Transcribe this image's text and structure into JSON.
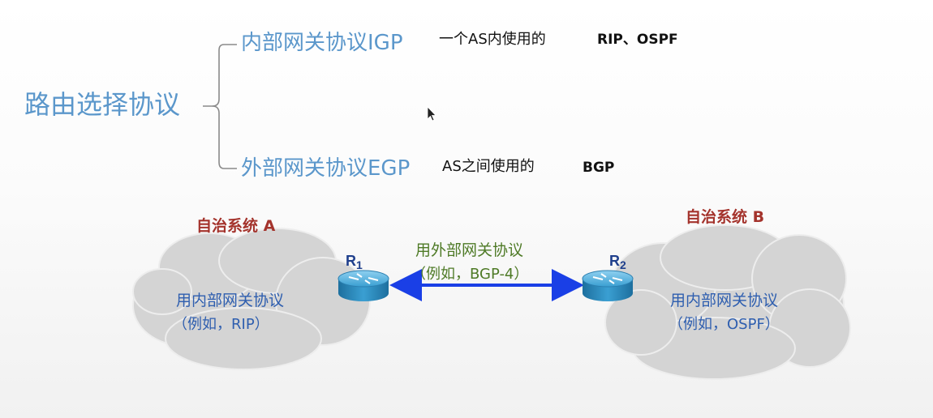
{
  "taxonomy": {
    "root": "路由选择协议",
    "igp": {
      "name": "内部网关协议IGP",
      "desc": "一个AS内使用的",
      "examples": "RIP、OSPF"
    },
    "egp": {
      "name": "外部网关协议EGP",
      "desc": "AS之间使用的",
      "examples": "BGP"
    }
  },
  "diagram": {
    "as_a": {
      "title": "自治系统 A",
      "line1": "用内部网关协议",
      "line2": "（例如，RIP）"
    },
    "as_b": {
      "title": "自治系统 B",
      "line1": "用内部网关协议",
      "line2": "（例如，OSPF）"
    },
    "link": {
      "line1": "用外部网关协议",
      "line2": "（例如，BGP-4）"
    },
    "router1": {
      "label": "R",
      "sub": "1"
    },
    "router2": {
      "label": "R",
      "sub": "2"
    }
  },
  "colors": {
    "heading_blue": "#5b97cb",
    "title_red": "#a4332c",
    "cloud_text_blue": "#2e5eaf",
    "link_green": "#4e7a26",
    "arrow_blue": "#1a3fe6",
    "cloud_fill": "#d4d4d4"
  }
}
